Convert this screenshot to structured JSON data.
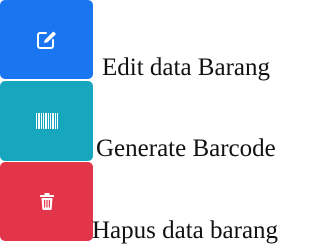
{
  "actions": [
    {
      "label": "Edit data Barang",
      "icon": "edit-icon",
      "color": "#1a76f0"
    },
    {
      "label": "Generate Barcode",
      "icon": "barcode-icon",
      "color": "#16a6bd"
    },
    {
      "label": "Hapus data barang",
      "icon": "trash-icon",
      "color": "#e3354a"
    }
  ]
}
